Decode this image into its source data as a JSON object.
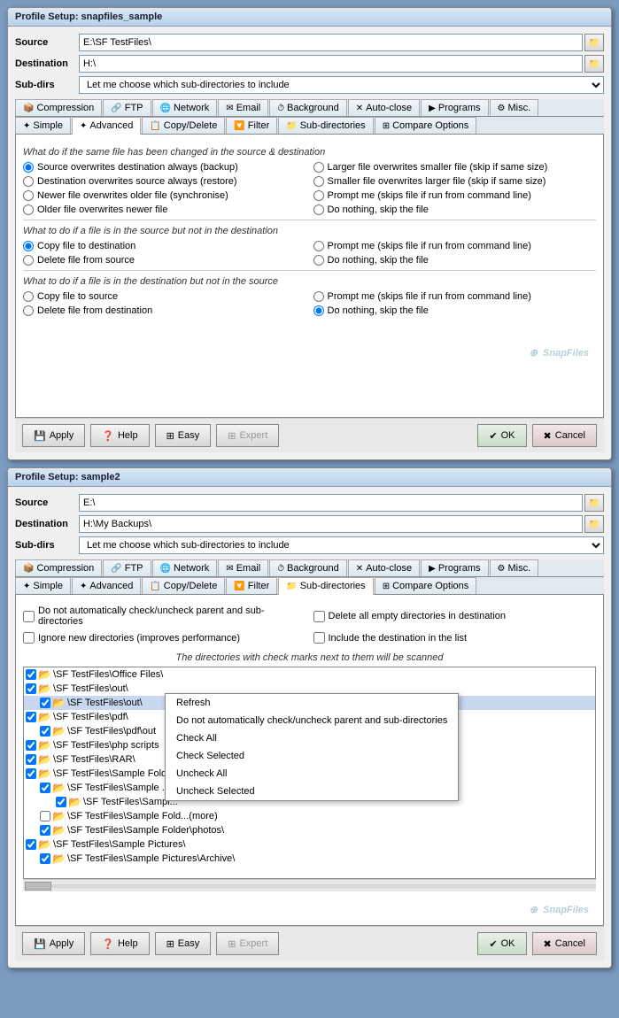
{
  "window1": {
    "title": "Profile Setup: snapfiles_sample",
    "source_label": "Source",
    "source_value": "E:\\SF TestFiles\\",
    "destination_label": "Destination",
    "destination_value": "H:\\",
    "subdirs_label": "Sub-dirs",
    "subdirs_value": "Let me choose which sub-directories to include",
    "tabs1": [
      {
        "id": "compression",
        "label": "Compression",
        "icon": "📦"
      },
      {
        "id": "ftp",
        "label": "FTP",
        "icon": "🔗"
      },
      {
        "id": "network",
        "label": "Network",
        "icon": "🖧"
      },
      {
        "id": "email",
        "label": "Email",
        "icon": "✉"
      },
      {
        "id": "background",
        "label": "Background",
        "icon": "⏱"
      },
      {
        "id": "autoclose",
        "label": "Auto-close",
        "icon": "✕"
      },
      {
        "id": "programs",
        "label": "Programs",
        "icon": "▶"
      },
      {
        "id": "misc",
        "label": "Misc.",
        "icon": "⚙"
      }
    ],
    "tabs2": [
      {
        "id": "simple",
        "label": "Simple",
        "icon": "✦"
      },
      {
        "id": "advanced",
        "label": "Advanced",
        "icon": "✦",
        "active": true
      },
      {
        "id": "copydel",
        "label": "Copy/Delete",
        "icon": "📋"
      },
      {
        "id": "filter",
        "label": "Filter",
        "icon": "🔽"
      },
      {
        "id": "subdirs",
        "label": "Sub-directories",
        "icon": "📁"
      },
      {
        "id": "compare",
        "label": "Compare Options",
        "icon": "⊞"
      }
    ],
    "section1_label": "What do if the same file has been changed in the source & destination",
    "radio_group1": [
      {
        "id": "r1a",
        "label": "Source overwrites destination always (backup)",
        "checked": true
      },
      {
        "id": "r1b",
        "label": "Larger file overwrites smaller file (skip if same size)",
        "checked": false
      },
      {
        "id": "r1c",
        "label": "Destination overwrites source always (restore)",
        "checked": false
      },
      {
        "id": "r1d",
        "label": "Smaller file overwrites larger file (skip if same size)",
        "checked": false
      },
      {
        "id": "r1e",
        "label": "Newer file overwrites older file (synchronise)",
        "checked": false
      },
      {
        "id": "r1f",
        "label": "Prompt me (skips file if run from command line)",
        "checked": false
      },
      {
        "id": "r1g",
        "label": "Older file overwrites newer file",
        "checked": false
      },
      {
        "id": "r1h",
        "label": "Do nothing, skip the file",
        "checked": false
      }
    ],
    "section2_label": "What to do if a file is in the source but not in the destination",
    "radio_group2": [
      {
        "id": "r2a",
        "label": "Copy file to destination",
        "checked": true
      },
      {
        "id": "r2b",
        "label": "Prompt me  (skips file if run from command line)",
        "checked": false
      },
      {
        "id": "r2c",
        "label": "Delete file from source",
        "checked": false
      },
      {
        "id": "r2d",
        "label": "Do nothing, skip the file",
        "checked": false
      }
    ],
    "section3_label": "What to do if a file is in the destination but not in the source",
    "radio_group3": [
      {
        "id": "r3a",
        "label": "Copy file to source",
        "checked": false
      },
      {
        "id": "r3b",
        "label": "Prompt me  (skips file if run from command line)",
        "checked": false
      },
      {
        "id": "r3c",
        "label": "Delete file from destination",
        "checked": false
      },
      {
        "id": "r3d",
        "label": "Do nothing, skip the file",
        "checked": true
      }
    ],
    "watermark": "SnapFiles",
    "buttons": {
      "apply": "Apply",
      "help": "Help",
      "easy": "Easy",
      "expert": "Expert",
      "ok": "OK",
      "cancel": "Cancel"
    }
  },
  "window2": {
    "title": "Profile Setup: sample2",
    "source_label": "Source",
    "source_value": "E:\\",
    "destination_label": "Destination",
    "destination_value": "H:\\My Backups\\",
    "subdirs_label": "Sub-dirs",
    "subdirs_value": "Let me choose which sub-directories to include",
    "tabs1": [
      {
        "id": "compression",
        "label": "Compression",
        "icon": "📦"
      },
      {
        "id": "ftp",
        "label": "FTP",
        "icon": "🔗"
      },
      {
        "id": "network",
        "label": "Network",
        "icon": "🖧"
      },
      {
        "id": "email",
        "label": "Email",
        "icon": "✉"
      },
      {
        "id": "background",
        "label": "Background",
        "icon": "⏱"
      },
      {
        "id": "autoclose",
        "label": "Auto-close",
        "icon": "✕"
      },
      {
        "id": "programs",
        "label": "Programs",
        "icon": "▶"
      },
      {
        "id": "misc",
        "label": "Misc.",
        "icon": "⚙"
      }
    ],
    "tabs2": [
      {
        "id": "simple",
        "label": "Simple",
        "icon": "✦"
      },
      {
        "id": "advanced",
        "label": "Advanced",
        "icon": "✦"
      },
      {
        "id": "copydel",
        "label": "Copy/Delete",
        "icon": "📋"
      },
      {
        "id": "filter",
        "label": "Filter",
        "icon": "🔽"
      },
      {
        "id": "subdirs",
        "label": "Sub-directories",
        "icon": "📁",
        "active": true
      },
      {
        "id": "compare",
        "label": "Compare Options",
        "icon": "⊞"
      }
    ],
    "checkboxes": [
      {
        "id": "cb1",
        "label": "Do not automatically check/uncheck parent and sub-directories",
        "checked": false
      },
      {
        "id": "cb2",
        "label": "Delete all empty directories in destination",
        "checked": false
      },
      {
        "id": "cb3",
        "label": "Ignore new directories (improves performance)",
        "checked": false
      },
      {
        "id": "cb4",
        "label": "Include the destination in the list",
        "checked": false
      }
    ],
    "scan_label": "The directories with check marks next to them will be scanned",
    "tree_items": [
      {
        "id": "t1",
        "label": "\\SF TestFiles\\Office Files\\",
        "indent": 0,
        "checked": true
      },
      {
        "id": "t2",
        "label": "\\SF TestFiles\\out\\",
        "indent": 0,
        "checked": true
      },
      {
        "id": "t3",
        "label": "\\SF TestFiles\\out\\",
        "indent": 1,
        "checked": true,
        "highlighted": true
      },
      {
        "id": "t4",
        "label": "\\SF TestFiles\\pdf\\",
        "indent": 0,
        "checked": true
      },
      {
        "id": "t5",
        "label": "\\SF TestFiles\\pdf\\out",
        "indent": 1,
        "checked": true
      },
      {
        "id": "t6",
        "label": "\\SF TestFiles\\php scripts",
        "indent": 0,
        "checked": true
      },
      {
        "id": "t7",
        "label": "\\SF TestFiles\\RAR\\",
        "indent": 0,
        "checked": true
      },
      {
        "id": "t8",
        "label": "\\SF TestFiles\\Sample Fold...",
        "indent": 0,
        "checked": true
      },
      {
        "id": "t9",
        "label": "\\SF TestFiles\\Sample ...",
        "indent": 1,
        "checked": true
      },
      {
        "id": "t10",
        "label": "\\SF TestFiles\\Sampl...",
        "indent": 2,
        "checked": true
      },
      {
        "id": "t11",
        "label": "\\SF TestFiles\\Sample Fold...(more)",
        "indent": 1,
        "checked": false
      },
      {
        "id": "t12",
        "label": "\\SF TestFiles\\Sample Folder\\photos\\",
        "indent": 1,
        "checked": true
      },
      {
        "id": "t13",
        "label": "\\SF TestFiles\\Sample Pictures\\",
        "indent": 0,
        "checked": true
      },
      {
        "id": "t14",
        "label": "\\SF TestFiles\\Sample Pictures\\Archive\\",
        "indent": 1,
        "checked": true
      }
    ],
    "context_menu_items": [
      "Refresh",
      "Do not automatically check/uncheck parent and sub-directories",
      "Check All",
      "Check Selected",
      "Uncheck All",
      "Uncheck Selected"
    ],
    "watermark": "SnapFiles",
    "buttons": {
      "apply": "Apply",
      "help": "Help",
      "easy": "Easy",
      "expert": "Expert",
      "ok": "OK",
      "cancel": "Cancel"
    }
  }
}
